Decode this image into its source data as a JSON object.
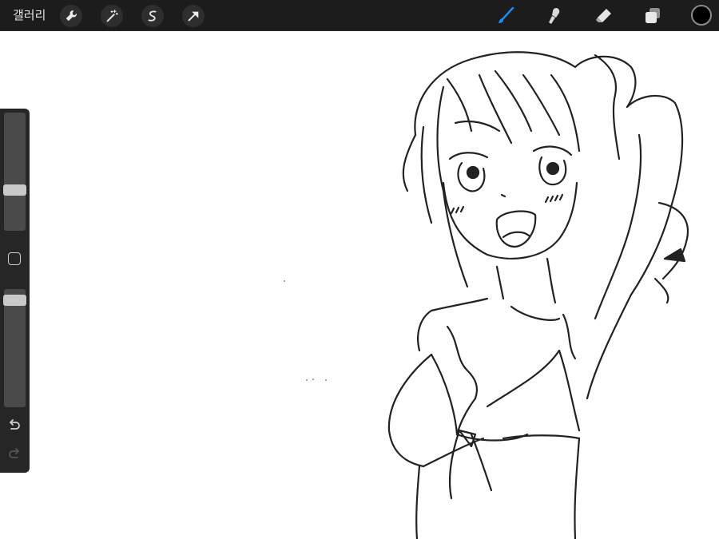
{
  "toolbar": {
    "gallery_label": "갤러리",
    "left_tools": [
      "wrench-icon",
      "magic-wand-icon",
      "selection-icon",
      "transform-arrow-icon"
    ],
    "right_tools": [
      "brush-icon",
      "smudge-icon",
      "eraser-icon",
      "layers-icon"
    ],
    "active_tool": "brush",
    "accent_color": "#1e8bff",
    "current_color": "#000000"
  },
  "sidebar": {
    "brush_size": 0.33,
    "opacity": 0.95,
    "undo_icon": "undo-icon",
    "redo_icon": "redo-icon"
  }
}
